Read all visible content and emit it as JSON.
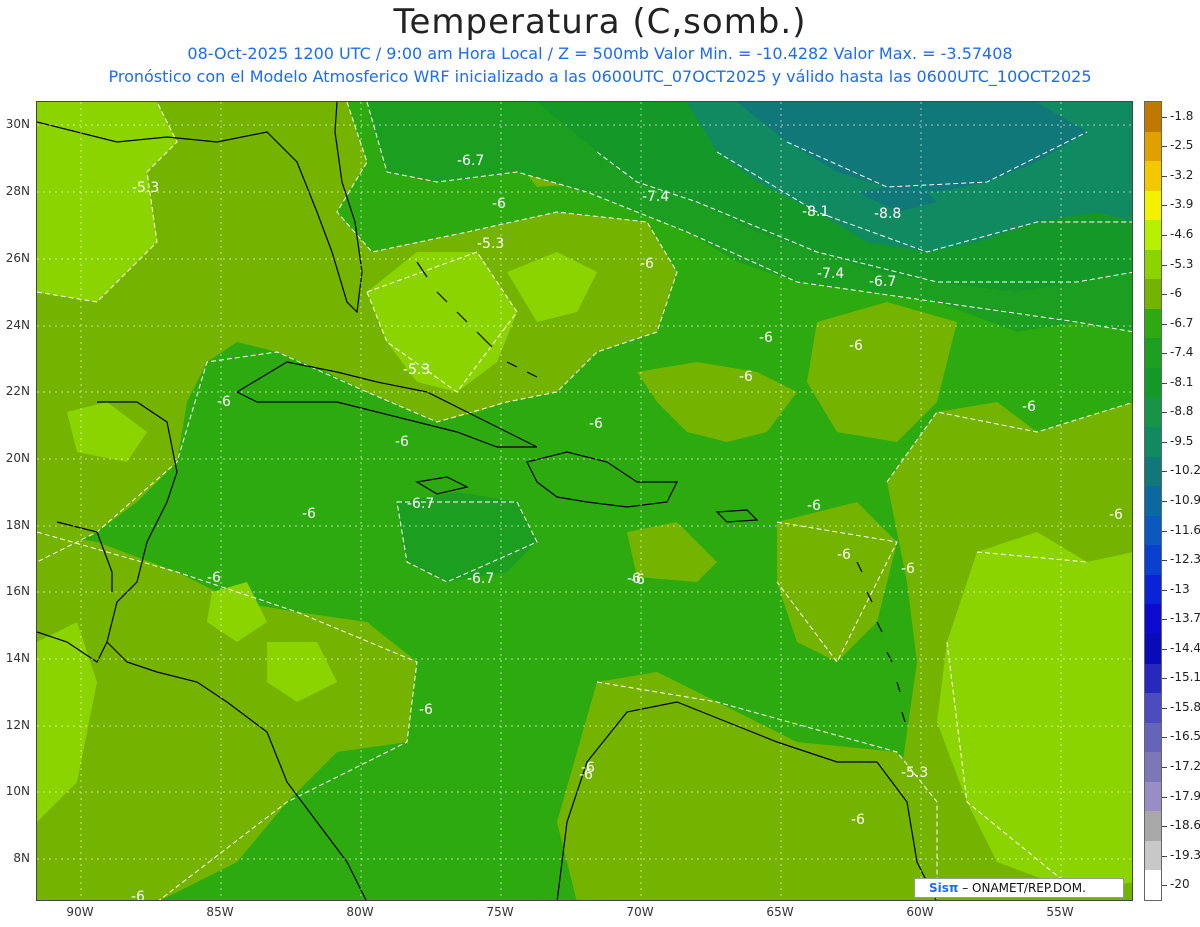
{
  "header": {
    "title": "Temperatura (C,somb.)",
    "line1": "08-Oct-2025  1200 UTC / 9:00 am Hora Local / Z = 500mb  Valor Min. = -10.4282  Valor Max. = -3.57408",
    "line2": "Pronóstico con el Modelo Atmosferico WRF inicializado a las 0600UTC_07OCT2025 y válido hasta las  0600UTC_10OCT2025"
  },
  "axes": {
    "lat_labels": [
      "30N",
      "28N",
      "26N",
      "24N",
      "22N",
      "20N",
      "18N",
      "16N",
      "14N",
      "12N",
      "10N",
      "8N"
    ],
    "lon_labels": [
      "90W",
      "85W",
      "80W",
      "75W",
      "70W",
      "65W",
      "60W",
      "55W"
    ]
  },
  "colorbar": {
    "levels": [
      "-1.8",
      "-2.5",
      "-3.2",
      "-3.9",
      "-4.6",
      "-5.3",
      "-6",
      "-6.7",
      "-7.4",
      "-8.1",
      "-8.8",
      "-9.5",
      "-10.2",
      "-10.9",
      "-11.6",
      "-12.3",
      "-13",
      "-13.7",
      "-14.4",
      "-15.1",
      "-15.8",
      "-16.5",
      "-17.2",
      "-17.9",
      "-18.6",
      "-19.3",
      "-20"
    ],
    "colors": [
      "#c07800",
      "#e0a000",
      "#f4c800",
      "#f2f200",
      "#b4f000",
      "#8cd400",
      "#74b400",
      "#2caa10",
      "#1c9e20",
      "#149828",
      "#189448",
      "#108a60",
      "#107878",
      "#0a6aa0",
      "#0a58c0",
      "#0a40d0",
      "#0a22d8",
      "#0a0ad0",
      "#0a0ab8",
      "#2828c0",
      "#4c4cc0",
      "#6464b8",
      "#7c78b8",
      "#9a8cc4",
      "#a8a8a8",
      "#c8c8c8",
      "#ffffff"
    ]
  },
  "contour_labels": [
    "-6.7",
    "-5.3",
    "-6",
    "-7.4",
    "-8.1",
    "-8.8",
    "-5.3",
    "-6",
    "-7.4",
    "-6.7",
    "-6",
    "-6",
    "-5.3",
    "-6",
    "-6",
    "-6",
    "-6",
    "-6",
    "-6",
    "-6",
    "-6.7",
    "-6",
    "-6",
    "-6",
    "-6",
    "-6",
    "-6.7",
    "-6",
    "-6",
    "-6",
    "-5.3",
    "-6",
    "-6",
    "-6"
  ],
  "credit": {
    "brand": "Sisπ",
    "text": " – ONAMET/REP.DOM."
  }
}
